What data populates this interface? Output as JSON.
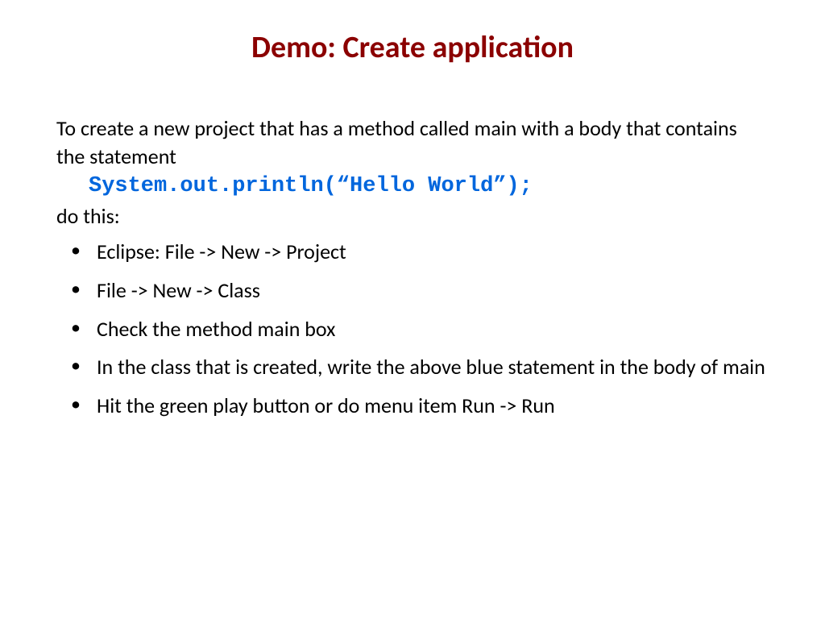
{
  "title": "Demo: Create application",
  "intro": "To create a new project that has a method called main with a body that contains the statement",
  "code": "System.out.println(“Hello World”);",
  "doThis": "do this:",
  "bullets": [
    "Eclipse: File -> New -> Project",
    "File -> New -> Class",
    "Check the method main box",
    "In the class that is created, write the above blue statement in the body of main",
    "Hit the green play button or do menu item Run -> Run"
  ]
}
